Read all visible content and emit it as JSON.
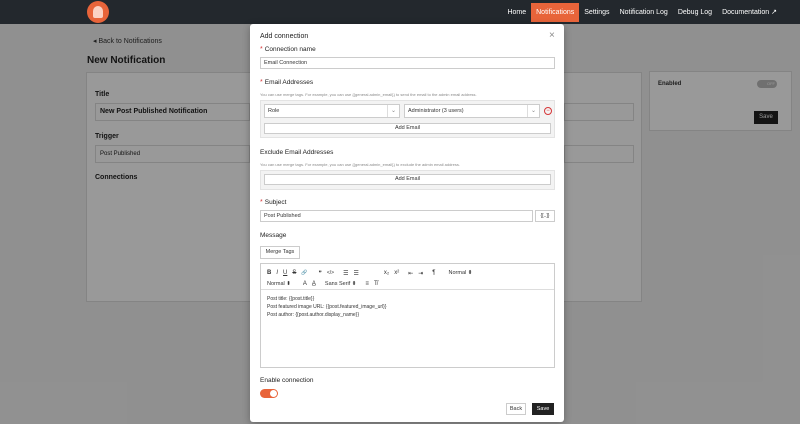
{
  "nav": {
    "items": [
      "Home",
      "Notifications",
      "Settings",
      "Notification Log",
      "Debug Log",
      "Documentation ↗"
    ],
    "active_index": 1
  },
  "background": {
    "back_link": "◂  Back to Notifications",
    "page_title": "New Notification",
    "title_label": "Title",
    "title_value": "New Post Published Notification",
    "trigger_label": "Trigger",
    "trigger_value": "Post Published",
    "connections_label": "Connections",
    "enabled_label": "Enabled",
    "toggle_text": "OFF",
    "save_label": "Save"
  },
  "modal": {
    "title": "Add connection",
    "close": "×",
    "connection_name_label": "Connection name",
    "connection_name_value": "Email Connection",
    "email_addresses_label": "Email Addresses",
    "email_help": "You can use merge tags. For example, you can use {{general.admin_email}} to send the email to the admin email address.",
    "role_label": "Role",
    "role_value": "Administrator (3 users)",
    "add_email": "Add Email",
    "exclude_label": "Exclude Email Addresses",
    "exclude_help": "You can use merge tags. For example, you can use {{general.admin_email}} to exclude the admin email address.",
    "subject_label": "Subject",
    "subject_value": "Post Published",
    "merge_icon": "{[..]}",
    "message_label": "Message",
    "merge_tags_button": "Merge Tags",
    "toolbar_row1": [
      "B",
      "I",
      "U",
      "S",
      "🔗",
      "❞",
      "</>",
      "☰",
      "☰",
      "x₂",
      "x²",
      "⇤",
      "⇥",
      "¶",
      "Normal ⬍"
    ],
    "toolbar_row2": [
      "Normal ⬍",
      "A",
      "A̲",
      "Sans Serif ⬍",
      "≡",
      "T̸"
    ],
    "content_lines": [
      "Post title: {{post.title}}",
      "Post featured image URL: {{post.featured_image_url}}",
      "Post author: {{post.author.display_name}}"
    ],
    "enable_label": "Enable connection",
    "back_label": "Back",
    "save_label": "Save"
  }
}
